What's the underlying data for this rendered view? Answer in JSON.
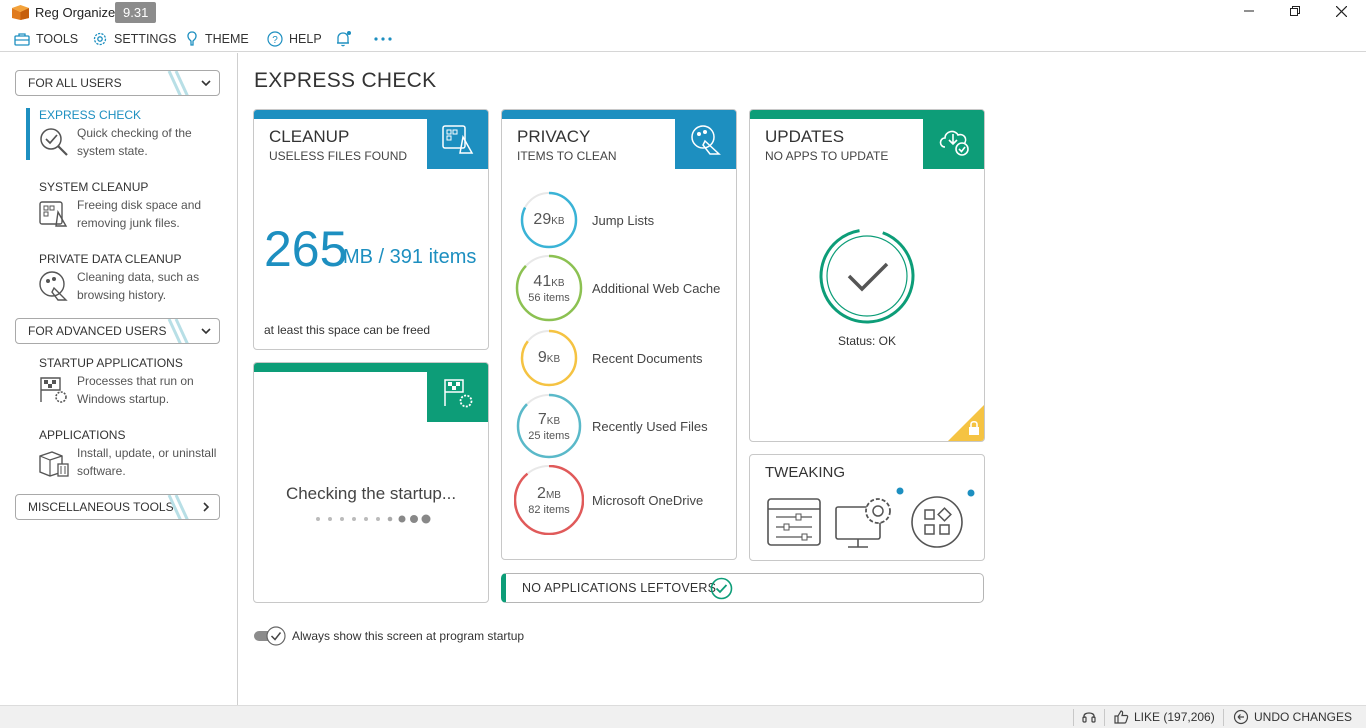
{
  "app": {
    "title": "Reg Organizer",
    "version": "9.31"
  },
  "menu": {
    "tools": "TOOLS",
    "settings": "SETTINGS",
    "theme": "THEME",
    "help": "HELP"
  },
  "sidebar": {
    "group_all": "FOR ALL USERS",
    "group_advanced": "FOR ADVANCED USERS",
    "group_misc": "MISCELLANEOUS TOOLS",
    "items": [
      {
        "title": "EXPRESS CHECK",
        "desc": "Quick checking of the system state."
      },
      {
        "title": "SYSTEM CLEANUP",
        "desc": "Freeing disk space and removing junk files."
      },
      {
        "title": "PRIVATE DATA CLEANUP",
        "desc": "Cleaning data, such as browsing history."
      },
      {
        "title": "STARTUP APPLICATIONS",
        "desc": "Processes that run on Windows startup."
      },
      {
        "title": "APPLICATIONS",
        "desc": "Install, update, or uninstall software."
      }
    ]
  },
  "main": {
    "title": "EXPRESS CHECK",
    "cleanup": {
      "title": "CLEANUP",
      "subtitle": "USELESS FILES FOUND",
      "size_value": "265",
      "size_rest": "MB / 391 items",
      "note": "at least this space can be freed"
    },
    "startup": {
      "status": "Checking the startup..."
    },
    "privacy": {
      "title": "PRIVACY",
      "subtitle": "ITEMS TO CLEAN",
      "items": [
        {
          "size": "29",
          "unit": "KB",
          "count": "",
          "label": "Jump Lists",
          "color": "#3ab3d6"
        },
        {
          "size": "41",
          "unit": "KB",
          "count": "56 items",
          "label": "Additional Web Cache",
          "color": "#8cc152"
        },
        {
          "size": "9",
          "unit": "KB",
          "count": "",
          "label": "Recent Documents",
          "color": "#f5c342"
        },
        {
          "size": "7",
          "unit": "KB",
          "count": "25 items",
          "label": "Recently Used Files",
          "color": "#5ab9c9"
        },
        {
          "size": "2",
          "unit": "MB",
          "count": "82 items",
          "label": "Microsoft OneDrive",
          "color": "#e05a5a"
        }
      ]
    },
    "updates": {
      "title": "UPDATES",
      "subtitle": "NO APPS TO UPDATE",
      "status": "Status: OK"
    },
    "tweaking": {
      "title": "TWEAKING"
    },
    "leftovers": {
      "label": "NO APPLICATIONS LEFTOVERS"
    },
    "startup_option": {
      "label": "Always show this screen at program startup",
      "enabled": true
    }
  },
  "statusbar": {
    "like": "LIKE (197,206)",
    "undo": "UNDO CHANGES"
  },
  "colors": {
    "blue": "#1d8fc0",
    "green": "#0d9d78",
    "yellow": "#f5c342"
  }
}
